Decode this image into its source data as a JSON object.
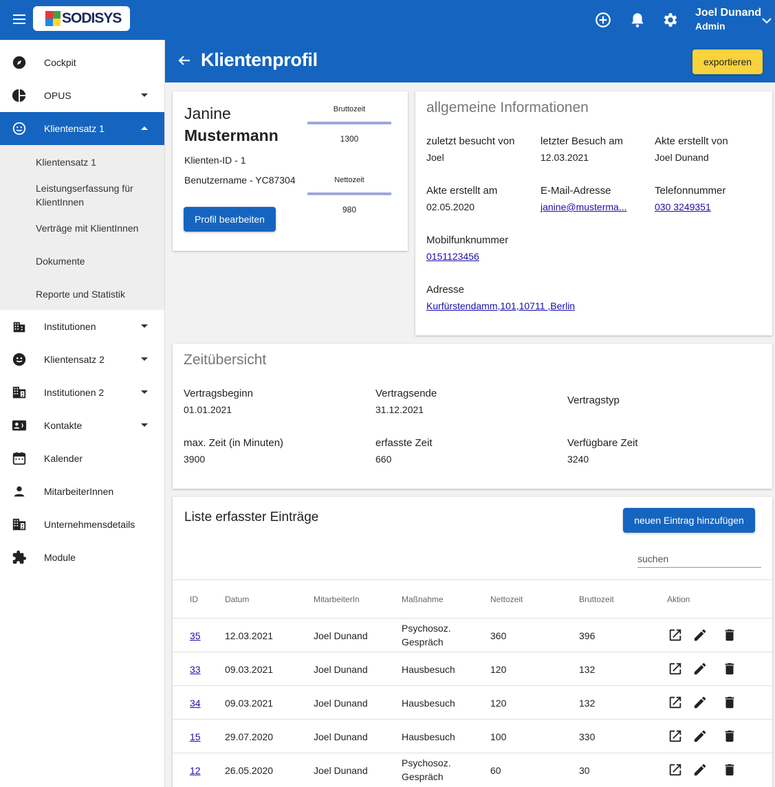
{
  "header": {
    "logo_text": "SODISYS",
    "user_name": "Joel Dunand",
    "user_role": "Admin",
    "brand_color": "#1565c0",
    "accent_color": "#f9d23c"
  },
  "sidebar": {
    "items": [
      {
        "label": "Cockpit",
        "icon": "compass-icon"
      },
      {
        "label": "OPUS",
        "icon": "pie-chart-icon"
      },
      {
        "label": "Klientensatz 1",
        "icon": "smiley-icon",
        "active": true
      },
      {
        "label": "Institutionen",
        "icon": "building-icon"
      },
      {
        "label": "Klientensatz 2",
        "icon": "smiley-icon"
      },
      {
        "label": "Institutionen 2",
        "icon": "building-icon"
      },
      {
        "label": "Kontakte",
        "icon": "contact-card-icon"
      },
      {
        "label": "Kalender",
        "icon": "calendar-icon"
      },
      {
        "label": "MitarbeiterInnen",
        "icon": "person-icon"
      },
      {
        "label": "Unternehmensdetails",
        "icon": "building-icon"
      },
      {
        "label": "Module",
        "icon": "puzzle-icon"
      }
    ],
    "subitems": [
      "Klientensatz 1",
      "Leistungserfassung für KlientInnen",
      "Verträge mit KlientInnen",
      "Dokumente",
      "Reporte und Statistik"
    ]
  },
  "page": {
    "title": "Klientenprofil",
    "export_label": "exportieren"
  },
  "profile": {
    "first_name": "Janine",
    "last_name": "Mustermann",
    "client_id": "Klienten-ID - 1",
    "username": "Benutzername - YC87304",
    "brutto_label": "Bruttozeit",
    "brutto_value": "1300",
    "netto_label": "Nettozeit",
    "netto_value": "980",
    "edit_label": "Profil bearbeiten"
  },
  "info": {
    "title": "allgemeine Informationen",
    "last_visited_by_label": "zuletzt besucht von",
    "last_visited_by": "Joel",
    "last_visit_label": "letzter Besuch am",
    "last_visit": "12.03.2021",
    "created_by_label": "Akte erstellt von",
    "created_by": "Joel Dunand",
    "created_on_label": "Akte erstellt am",
    "created_on": "02.05.2020",
    "email_label": "E-Mail-Adresse",
    "email": "janine@musterma...",
    "phone_label": "Telefonnummer",
    "phone": "030 3249351",
    "mobile_label": "Mobilfunknummer",
    "mobile": "0151123456",
    "address_label": "Adresse",
    "address": "Kurfürstendamm,101,10711 ,Berlin"
  },
  "time": {
    "title": "Zeitübersicht",
    "contract_start_label": "Vertragsbeginn",
    "contract_start": "01.01.2021",
    "contract_end_label": "Vertragsende",
    "contract_end": "31.12.2021",
    "contract_type_label": "Vertragstyp",
    "max_time_label": "max. Zeit (in Minuten)",
    "max_time": "3900",
    "recorded_label": "erfasste Zeit",
    "recorded": "660",
    "available_label": "Verfügbare Zeit",
    "available": "3240"
  },
  "entries": {
    "title": "Liste erfasster Einträge",
    "add_label": "neuen Eintrag hinzufügen",
    "search_placeholder": "suchen",
    "columns": [
      "ID",
      "Datum",
      "MitarbeiterIn",
      "Maßnahme",
      "Nettozeit",
      "Bruttozeit",
      "Aktion"
    ],
    "rows": [
      {
        "id": "35",
        "date": "12.03.2021",
        "staff": "Joel Dunand",
        "measure_1": "Psychosoz.",
        "measure_2": "Gespräch",
        "net": "360",
        "gross": "396"
      },
      {
        "id": "33",
        "date": "09.03.2021",
        "staff": "Joel Dunand",
        "measure_1": "Hausbesuch",
        "measure_2": "",
        "net": "120",
        "gross": "132"
      },
      {
        "id": "34",
        "date": "09.03.2021",
        "staff": "Joel Dunand",
        "measure_1": "Hausbesuch",
        "measure_2": "",
        "net": "120",
        "gross": "132"
      },
      {
        "id": "15",
        "date": "29.07.2020",
        "staff": "Joel Dunand",
        "measure_1": "Hausbesuch",
        "measure_2": "",
        "net": "100",
        "gross": "330"
      },
      {
        "id": "12",
        "date": "26.05.2020",
        "staff": "Joel Dunand",
        "measure_1": "Psychosoz.",
        "measure_2": "Gespräch",
        "net": "60",
        "gross": "30"
      }
    ]
  }
}
